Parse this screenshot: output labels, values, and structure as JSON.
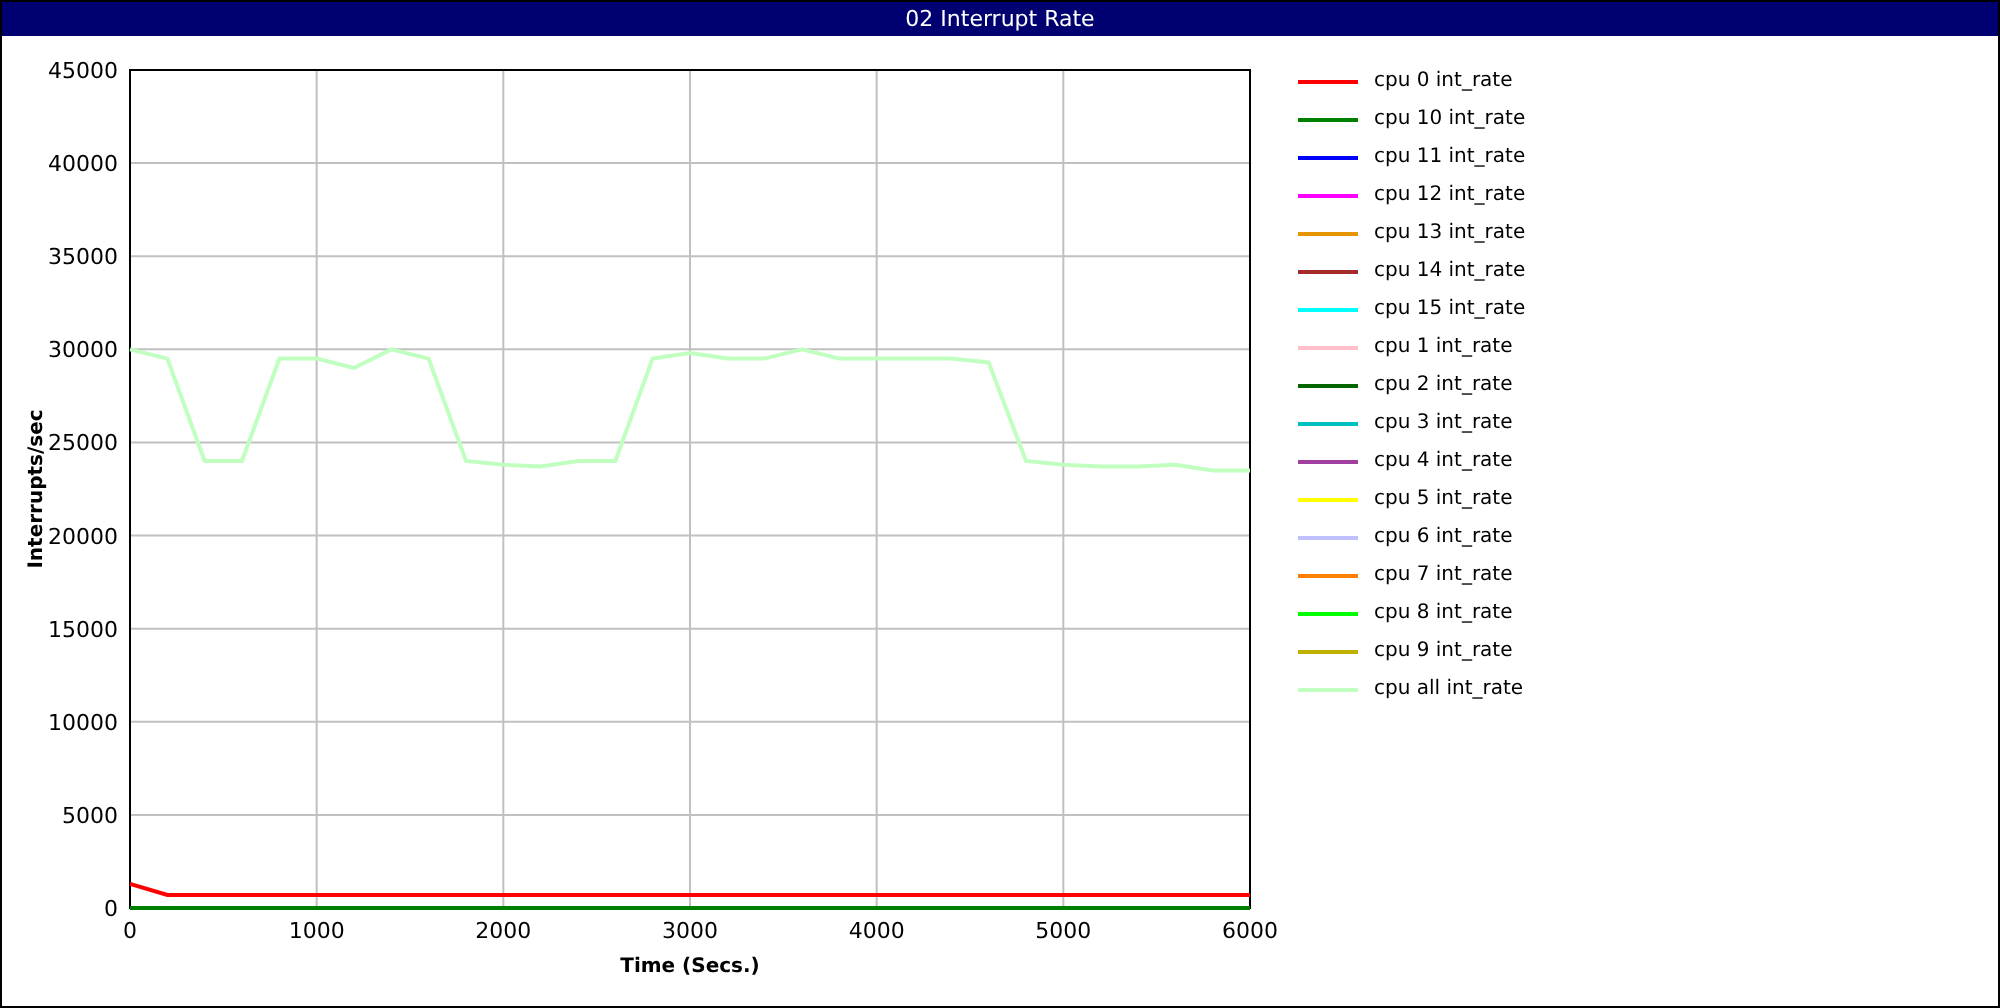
{
  "window": {
    "title": "02 Interrupt Rate"
  },
  "chart": {
    "chart_data": {
      "type": "line",
      "xlabel": "Time (Secs.)",
      "ylabel": "Interrupts/sec",
      "xlim": [
        0,
        6000
      ],
      "ylim": [
        0,
        45000
      ],
      "grid": true,
      "xticks": [
        0,
        1000,
        2000,
        3000,
        4000,
        5000,
        6000
      ],
      "yticks": [
        0,
        5000,
        10000,
        15000,
        20000,
        25000,
        30000,
        35000,
        40000,
        45000
      ],
      "x": [
        0,
        200,
        400,
        600,
        800,
        1000,
        1200,
        1400,
        1600,
        1800,
        2000,
        2200,
        2400,
        2600,
        2800,
        3000,
        3200,
        3400,
        3600,
        3800,
        4000,
        4200,
        4400,
        4600,
        4800,
        5000,
        5200,
        5400,
        5600,
        5800,
        6000
      ],
      "series": [
        {
          "name": "cpu 0 int_rate",
          "color": "#ff0000",
          "values": [
            1300,
            700,
            700,
            700,
            700,
            700,
            700,
            700,
            700,
            700,
            700,
            700,
            700,
            700,
            700,
            700,
            700,
            700,
            700,
            700,
            700,
            700,
            700,
            700,
            700,
            700,
            700,
            700,
            700,
            700,
            700
          ]
        },
        {
          "name": "cpu 10 int_rate",
          "color": "#008000",
          "values": [
            0,
            0,
            0,
            0,
            0,
            0,
            0,
            0,
            0,
            0,
            0,
            0,
            0,
            0,
            0,
            0,
            0,
            0,
            0,
            0,
            0,
            0,
            0,
            0,
            0,
            0,
            0,
            0,
            0,
            0,
            0
          ]
        },
        {
          "name": "cpu 11 int_rate",
          "color": "#0000ff",
          "values": [
            null,
            null,
            null,
            null,
            null,
            null,
            null,
            null,
            null,
            null,
            null,
            null,
            null,
            null,
            null,
            null,
            null,
            null,
            null,
            null,
            null,
            null,
            null,
            null,
            null,
            null,
            null,
            null,
            null,
            null,
            null
          ]
        },
        {
          "name": "cpu 12 int_rate",
          "color": "#ff00ff",
          "values": [
            null,
            null,
            null,
            null,
            null,
            null,
            null,
            null,
            null,
            null,
            null,
            null,
            null,
            null,
            null,
            null,
            null,
            null,
            null,
            null,
            null,
            null,
            null,
            null,
            null,
            null,
            null,
            null,
            null,
            null,
            null
          ]
        },
        {
          "name": "cpu 13 int_rate",
          "color": "#e69500",
          "values": [
            null,
            null,
            null,
            null,
            null,
            null,
            null,
            null,
            null,
            null,
            null,
            null,
            null,
            null,
            null,
            null,
            null,
            null,
            null,
            null,
            null,
            null,
            null,
            null,
            null,
            null,
            null,
            null,
            null,
            null,
            null
          ]
        },
        {
          "name": "cpu 14 int_rate",
          "color": "#a52a2a",
          "values": [
            null,
            null,
            null,
            null,
            null,
            null,
            null,
            null,
            null,
            null,
            null,
            null,
            null,
            null,
            null,
            null,
            null,
            null,
            null,
            null,
            null,
            null,
            null,
            null,
            null,
            null,
            null,
            null,
            null,
            null,
            null
          ]
        },
        {
          "name": "cpu 15 int_rate",
          "color": "#00ffff",
          "values": [
            null,
            null,
            null,
            null,
            null,
            null,
            null,
            null,
            null,
            null,
            null,
            null,
            null,
            null,
            null,
            null,
            null,
            null,
            null,
            null,
            null,
            null,
            null,
            null,
            null,
            null,
            null,
            null,
            null,
            null,
            null
          ]
        },
        {
          "name": "cpu 1 int_rate",
          "color": "#ffc0cb",
          "values": [
            null,
            null,
            null,
            null,
            null,
            null,
            null,
            null,
            null,
            null,
            null,
            null,
            null,
            null,
            null,
            null,
            null,
            null,
            null,
            null,
            null,
            null,
            null,
            null,
            null,
            null,
            null,
            null,
            null,
            null,
            null
          ]
        },
        {
          "name": "cpu 2 int_rate",
          "color": "#006400",
          "values": [
            null,
            null,
            null,
            null,
            null,
            null,
            null,
            null,
            null,
            null,
            null,
            null,
            null,
            null,
            null,
            null,
            null,
            null,
            null,
            null,
            null,
            null,
            null,
            null,
            null,
            null,
            null,
            null,
            null,
            null,
            null
          ]
        },
        {
          "name": "cpu 3 int_rate",
          "color": "#00c0c0",
          "values": [
            null,
            null,
            null,
            null,
            null,
            null,
            null,
            null,
            null,
            null,
            null,
            null,
            null,
            null,
            null,
            null,
            null,
            null,
            null,
            null,
            null,
            null,
            null,
            null,
            null,
            null,
            null,
            null,
            null,
            null,
            null
          ]
        },
        {
          "name": "cpu 4 int_rate",
          "color": "#a040a0",
          "values": [
            null,
            null,
            null,
            null,
            null,
            null,
            null,
            null,
            null,
            null,
            null,
            null,
            null,
            null,
            null,
            null,
            null,
            null,
            null,
            null,
            null,
            null,
            null,
            null,
            null,
            null,
            null,
            null,
            null,
            null,
            null
          ]
        },
        {
          "name": "cpu 5 int_rate",
          "color": "#ffff00",
          "values": [
            null,
            null,
            null,
            null,
            null,
            null,
            null,
            null,
            null,
            null,
            null,
            null,
            null,
            null,
            null,
            null,
            null,
            null,
            null,
            null,
            null,
            null,
            null,
            null,
            null,
            null,
            null,
            null,
            null,
            null,
            null
          ]
        },
        {
          "name": "cpu 6 int_rate",
          "color": "#c0c0ff",
          "values": [
            null,
            null,
            null,
            null,
            null,
            null,
            null,
            null,
            null,
            null,
            null,
            null,
            null,
            null,
            null,
            null,
            null,
            null,
            null,
            null,
            null,
            null,
            null,
            null,
            null,
            null,
            null,
            null,
            null,
            null,
            null
          ]
        },
        {
          "name": "cpu 7 int_rate",
          "color": "#ff8000",
          "values": [
            null,
            null,
            null,
            null,
            null,
            null,
            null,
            null,
            null,
            null,
            null,
            null,
            null,
            null,
            null,
            null,
            null,
            null,
            null,
            null,
            null,
            null,
            null,
            null,
            null,
            null,
            null,
            null,
            null,
            null,
            null
          ]
        },
        {
          "name": "cpu 8 int_rate",
          "color": "#00ff00",
          "values": [
            null,
            null,
            null,
            null,
            null,
            null,
            null,
            null,
            null,
            null,
            null,
            null,
            null,
            null,
            null,
            null,
            null,
            null,
            null,
            null,
            null,
            null,
            null,
            null,
            null,
            null,
            null,
            null,
            null,
            null,
            null
          ]
        },
        {
          "name": "cpu 9 int_rate",
          "color": "#c0b000",
          "values": [
            null,
            null,
            null,
            null,
            null,
            null,
            null,
            null,
            null,
            null,
            null,
            null,
            null,
            null,
            null,
            null,
            null,
            null,
            null,
            null,
            null,
            null,
            null,
            null,
            null,
            null,
            null,
            null,
            null,
            null,
            null
          ]
        },
        {
          "name": "cpu all int_rate",
          "color": "#c0ffc0",
          "values": [
            30000,
            29500,
            24000,
            24000,
            29500,
            29500,
            29000,
            30000,
            29500,
            24000,
            23800,
            23700,
            24000,
            24000,
            29500,
            29800,
            29500,
            29500,
            30000,
            29500,
            29500,
            29500,
            29500,
            29300,
            24000,
            23800,
            23700,
            23700,
            23800,
            23500,
            23500
          ]
        }
      ]
    }
  }
}
